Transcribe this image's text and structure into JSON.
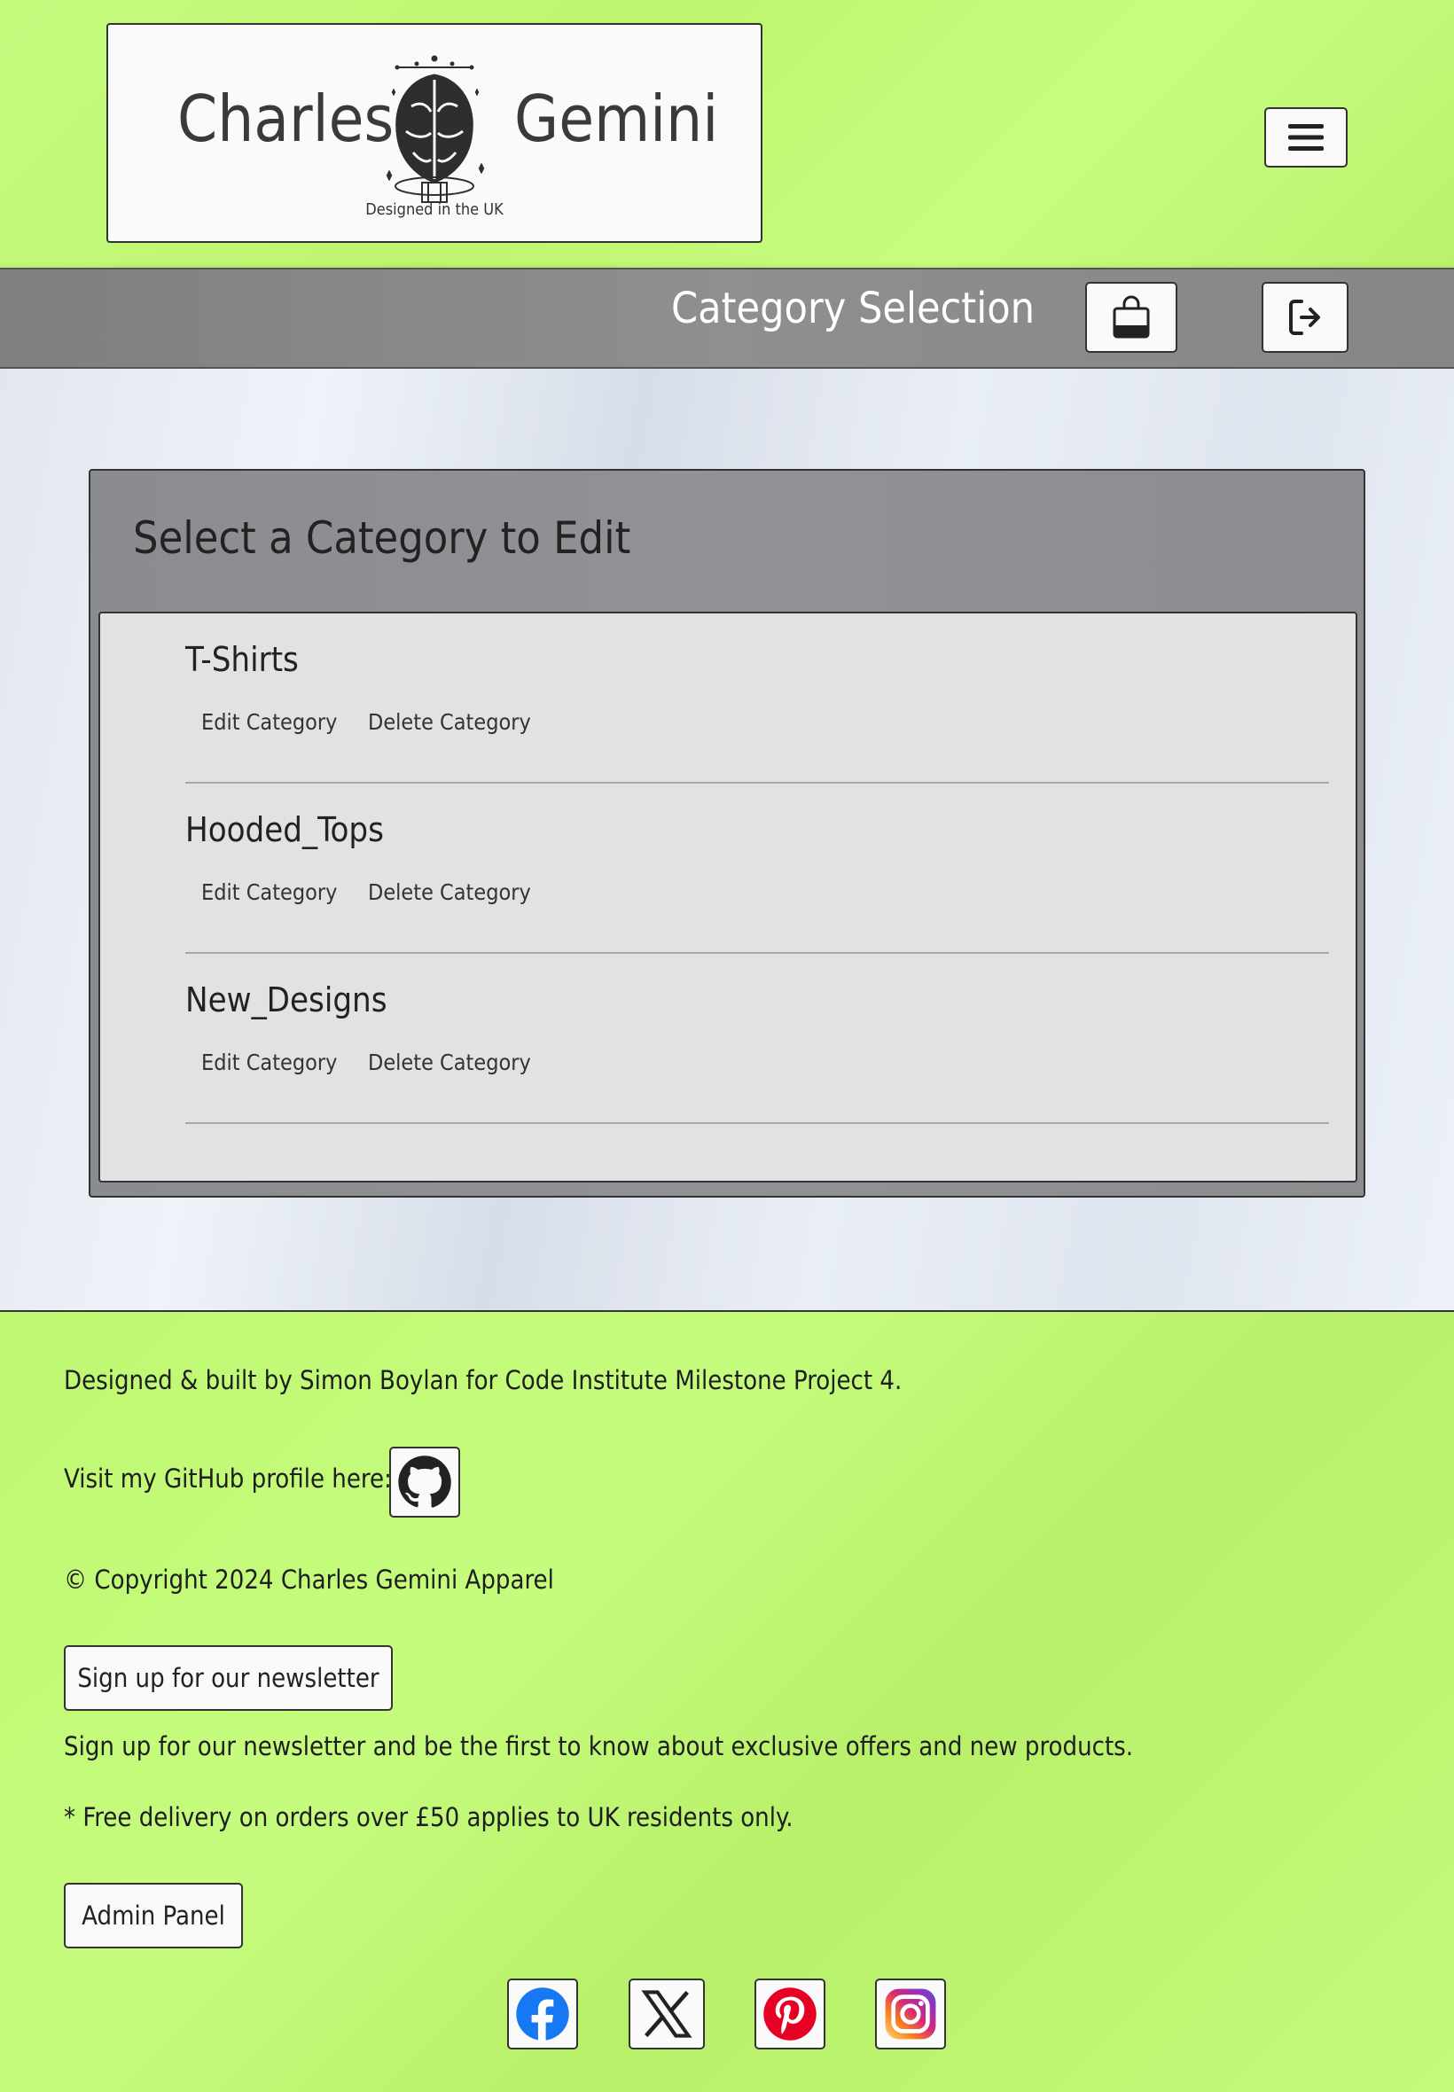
{
  "header": {
    "logo_left": "Charles",
    "logo_right": "Gemini",
    "logo_tagline": "Designed in the UK"
  },
  "navbar": {
    "title": "Category Selection"
  },
  "panel": {
    "title": "Select a Category to Edit",
    "categories": [
      {
        "name": "T-Shirts",
        "edit_label": "Edit Category",
        "delete_label": "Delete Category"
      },
      {
        "name": "Hooded_Tops",
        "edit_label": "Edit Category",
        "delete_label": "Delete Category"
      },
      {
        "name": "New_Designs",
        "edit_label": "Edit Category",
        "delete_label": "Delete Category"
      }
    ]
  },
  "footer": {
    "credit": "Designed & built by Simon Boylan for Code Institute Milestone Project 4.",
    "github_text": "Visit my GitHub profile here:",
    "copyright": "© Copyright 2024 Charles Gemini Apparel",
    "newsletter_button": "Sign up for our newsletter",
    "newsletter_text": "Sign up for our newsletter and be the first to know about exclusive offers and new products.",
    "delivery_note": "* Free delivery on orders over £50 applies to UK residents only.",
    "admin_button": "Admin Panel"
  },
  "colors": {
    "accent_green": "#c1f874",
    "navbar_grey": "#888888",
    "facebook": "#1877f2",
    "pinterest": "#e60023"
  },
  "icons": {
    "menu": "hamburger-icon",
    "bag": "shopping-bag-icon",
    "logout": "logout-icon",
    "github": "github-icon",
    "facebook": "facebook-icon",
    "x": "x-twitter-icon",
    "pinterest": "pinterest-icon",
    "instagram": "instagram-icon"
  }
}
